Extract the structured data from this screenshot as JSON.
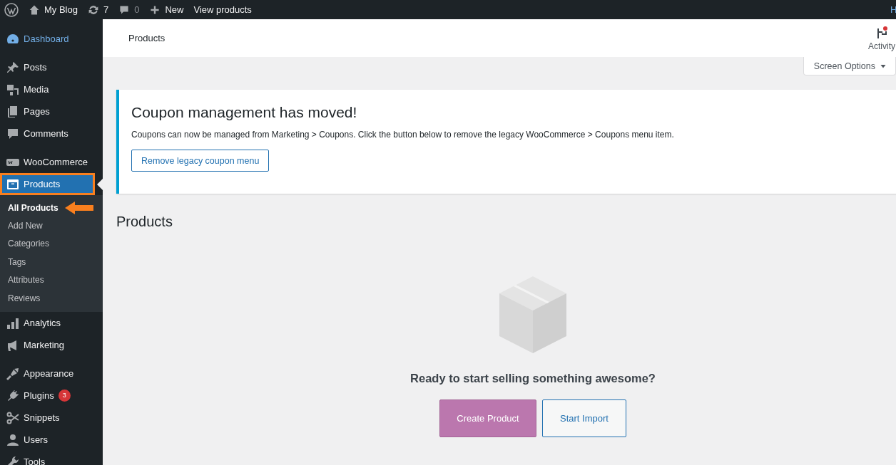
{
  "admin_bar": {
    "site": "My Blog",
    "updates": "7",
    "comments": "0",
    "new": "New",
    "view": "View products",
    "account": "H"
  },
  "sidebar": {
    "groups": [
      [
        {
          "label": "Dashboard",
          "selected": false,
          "hovered": true,
          "highlighted": false
        }
      ],
      [
        {
          "label": "Posts",
          "selected": false,
          "hovered": false,
          "highlighted": false
        },
        {
          "label": "Media",
          "selected": false,
          "hovered": false,
          "highlighted": false
        },
        {
          "label": "Pages",
          "selected": false,
          "hovered": false,
          "highlighted": false
        },
        {
          "label": "Comments",
          "selected": false,
          "hovered": false,
          "highlighted": false
        }
      ],
      [
        {
          "label": "WooCommerce",
          "selected": false,
          "hovered": false,
          "highlighted": false
        },
        {
          "label": "Products",
          "selected": true,
          "hovered": false,
          "highlighted": true,
          "submenu": [
            {
              "label": "All Products",
              "selected": true,
              "pointed": true
            },
            {
              "label": "Add New",
              "selected": false,
              "pointed": false
            },
            {
              "label": "Categories",
              "selected": false,
              "pointed": false
            },
            {
              "label": "Tags",
              "selected": false,
              "pointed": false
            },
            {
              "label": "Attributes",
              "selected": false,
              "pointed": false
            },
            {
              "label": "Reviews",
              "selected": false,
              "pointed": false
            }
          ]
        },
        {
          "label": "Analytics",
          "selected": false,
          "hovered": false,
          "highlighted": false
        },
        {
          "label": "Marketing",
          "selected": false,
          "hovered": false,
          "highlighted": false
        }
      ],
      [
        {
          "label": "Appearance",
          "selected": false,
          "hovered": false,
          "highlighted": false
        },
        {
          "label": "Plugins",
          "selected": false,
          "hovered": false,
          "highlighted": false,
          "badge": "3"
        },
        {
          "label": "Snippets",
          "selected": false,
          "hovered": false,
          "highlighted": false
        },
        {
          "label": "Users",
          "selected": false,
          "hovered": false,
          "highlighted": false
        },
        {
          "label": "Tools",
          "selected": false,
          "hovered": false,
          "highlighted": false
        }
      ]
    ]
  },
  "header": {
    "title": "Products",
    "activity": {
      "label": "Activity",
      "unread": true
    }
  },
  "screen_options": "Screen Options",
  "notice": {
    "title": "Coupon management has moved!",
    "text": "Coupons can now be managed from Marketing > Coupons. Click the button below to remove the legacy WooCommerce > Coupons menu item.",
    "button": "Remove legacy coupon menu"
  },
  "heading": "Products",
  "empty_state": {
    "message": "Ready to start selling something awesome?",
    "buttons": [
      {
        "label": "Create Product",
        "kind": "primary"
      },
      {
        "label": "Start Import",
        "kind": "secondary"
      }
    ]
  }
}
